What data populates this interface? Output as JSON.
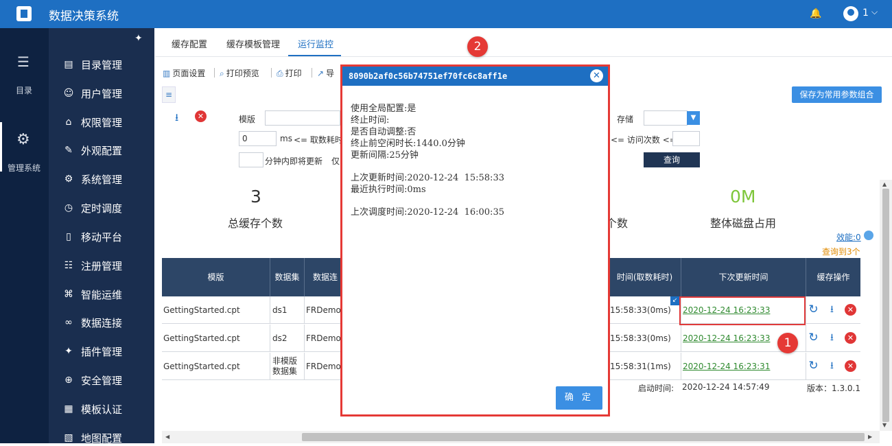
{
  "app": {
    "title": "数据决策系统",
    "user_count": "1"
  },
  "rail": [
    {
      "label": "目录",
      "icon": "list-icon"
    },
    {
      "label": "管理系统",
      "icon": "gear-icon"
    }
  ],
  "menu": [
    {
      "label": "目录管理",
      "icon": "catalog-icon"
    },
    {
      "label": "用户管理",
      "icon": "user-icon"
    },
    {
      "label": "权限管理",
      "icon": "lock-icon"
    },
    {
      "label": "外观配置",
      "icon": "brush-icon"
    },
    {
      "label": "系统管理",
      "icon": "settings-icon"
    },
    {
      "label": "定时调度",
      "icon": "timer-icon"
    },
    {
      "label": "移动平台",
      "icon": "mobile-icon"
    },
    {
      "label": "注册管理",
      "icon": "register-icon"
    },
    {
      "label": "智能运维",
      "icon": "ops-icon"
    },
    {
      "label": "数据连接",
      "icon": "link-icon"
    },
    {
      "label": "插件管理",
      "icon": "plugin-icon"
    },
    {
      "label": "安全管理",
      "icon": "shield-icon"
    },
    {
      "label": "模板认证",
      "icon": "template-icon"
    },
    {
      "label": "地图配置",
      "icon": "map-icon"
    }
  ],
  "tabs": [
    "缓存配置",
    "缓存模板管理",
    "运行监控"
  ],
  "toolbar": {
    "page_setup": "页面设置",
    "print_preview": "打印预览",
    "print": "打印",
    "export": "导"
  },
  "save_params_button": "保存为常用参数组合",
  "filters": {
    "template_label": "模版",
    "storage_label": "存储",
    "ms_value": "0",
    "ms_unit": "ms",
    "fetch_time_label": "<=  取数耗时",
    "visit_count_label": "<=  访问次数  <=",
    "minutes_value": "",
    "minutes_label": "分钟内即将更新",
    "only_label": "仅",
    "query_button": "查询"
  },
  "stats": [
    {
      "value": "3",
      "label": "总缓存个数"
    },
    {
      "value": "",
      "label": "个数"
    },
    {
      "value": "0M",
      "label": "整体磁盘占用"
    }
  ],
  "efficiency_link": "效能:0",
  "found_text": "查询到3个",
  "table": {
    "headers": [
      "模版",
      "数据集",
      "数据连",
      "时间(取数耗时)",
      "下次更新时间",
      "缓存操作"
    ],
    "rows": [
      {
        "template": "GettingStarted.cpt",
        "dataset": "ds1",
        "connection": "FRDemo",
        "time": "15:58:33(0ms)",
        "next_update": "2020-12-24 16:23:33"
      },
      {
        "template": "GettingStarted.cpt",
        "dataset": "ds2",
        "connection": "FRDemo",
        "time": "15:58:33(0ms)",
        "next_update": "2020-12-24 16:23:33"
      },
      {
        "template": "GettingStarted.cpt",
        "dataset": "非模版数据集",
        "connection": "FRDemo",
        "time": "15:58:31(1ms)",
        "next_update": "2020-12-24 16:23:31"
      }
    ]
  },
  "footer": {
    "start_label": "启动时间:",
    "start_value": "2020-12-24 14:57:49",
    "version": "版本：1.3.0.1"
  },
  "badges": [
    "1",
    "2"
  ],
  "dialog": {
    "title": "8090b2af0c56b74751ef70fc6c8aff1e",
    "lines": [
      "使用全局配置:是",
      "终止时间:",
      "是否自动调整:否",
      "终止前空闲时长:1440.0分钟",
      "更新间隔:25分钟",
      "上次更新时间:2020-12-24  15:58:33",
      "最近执行时间:0ms",
      "上次调度时间:2020-12-24  16:00:35"
    ],
    "ok_button": "确 定"
  }
}
